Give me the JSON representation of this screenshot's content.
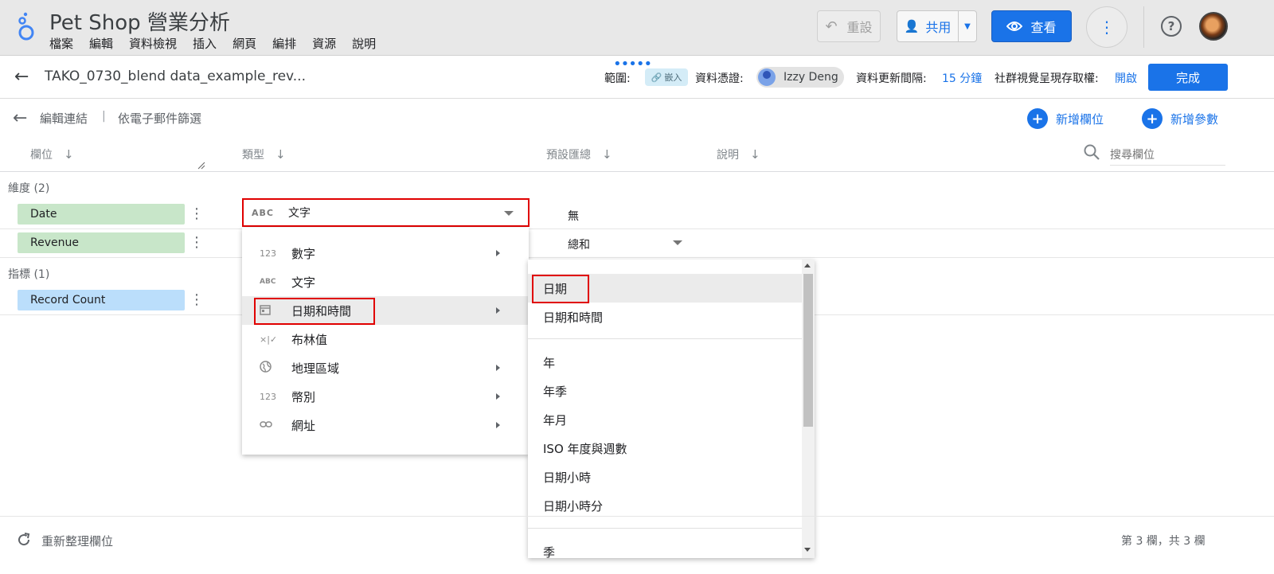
{
  "app": {
    "title": "Pet Shop 營業分析",
    "menu": [
      "檔案",
      "編輯",
      "資料檢視",
      "插入",
      "網頁",
      "編排",
      "資源",
      "說明"
    ],
    "reset_label": "重設",
    "share_label": "共用",
    "view_label": "查看"
  },
  "datasource": {
    "name": "TAKO_0730_blend data_example_rev...",
    "scope_label": "範圍:",
    "embed_chip": "嵌入",
    "cred_label": "資料憑證:",
    "cred_user": "Izzy Deng",
    "refresh_label": "資料更新間隔:",
    "refresh_value": "15 分鐘",
    "community_label": "社群視覺呈現存取權:",
    "community_value": "開啟",
    "done_label": "完成"
  },
  "breadcrumb": {
    "edit_connection": "編輯連結",
    "separator": "|",
    "current": "依電子郵件篩選"
  },
  "actions": {
    "add_field": "新增欄位",
    "add_param": "新增參數"
  },
  "columns": {
    "field": "欄位",
    "type": "類型",
    "default_agg": "預設匯總",
    "description": "說明",
    "search_placeholder": "搜尋欄位"
  },
  "dimensions": {
    "label": "維度 (2)",
    "rows": [
      {
        "name": "Date",
        "type": "文字",
        "type_icon": "ABC",
        "agg": "無"
      },
      {
        "name": "Revenue",
        "agg": "總和"
      }
    ]
  },
  "metrics": {
    "label": "指標 (1)",
    "rows": [
      {
        "name": "Record Count"
      }
    ]
  },
  "type_menu": [
    {
      "icon": "123",
      "label": "數字",
      "submenu": true
    },
    {
      "icon": "ABC",
      "label": "文字",
      "submenu": false
    },
    {
      "icon": "calendar-icon",
      "label": "日期和時間",
      "submenu": true
    },
    {
      "icon": "×|✓",
      "label": "布林值",
      "submenu": false
    },
    {
      "icon": "globe-icon",
      "label": "地理區域",
      "submenu": true
    },
    {
      "icon": "123",
      "label": "幣別",
      "submenu": true
    },
    {
      "icon": "link-icon",
      "label": "網址",
      "submenu": true
    }
  ],
  "date_submenu": {
    "group1": [
      "日期",
      "日期和時間"
    ],
    "group2": [
      "年",
      "年季",
      "年月",
      "ISO 年度與週數",
      "日期小時",
      "日期小時分"
    ],
    "group3": [
      "季"
    ]
  },
  "footer": {
    "refresh_fields": "重新整理欄位",
    "count": "第 3 欄，共 3 欄"
  },
  "colors": {
    "accent": "#1a73e8",
    "dimension_chip": "#c8e6c9",
    "metric_chip": "#bbdefb",
    "highlight": "#e00000"
  }
}
